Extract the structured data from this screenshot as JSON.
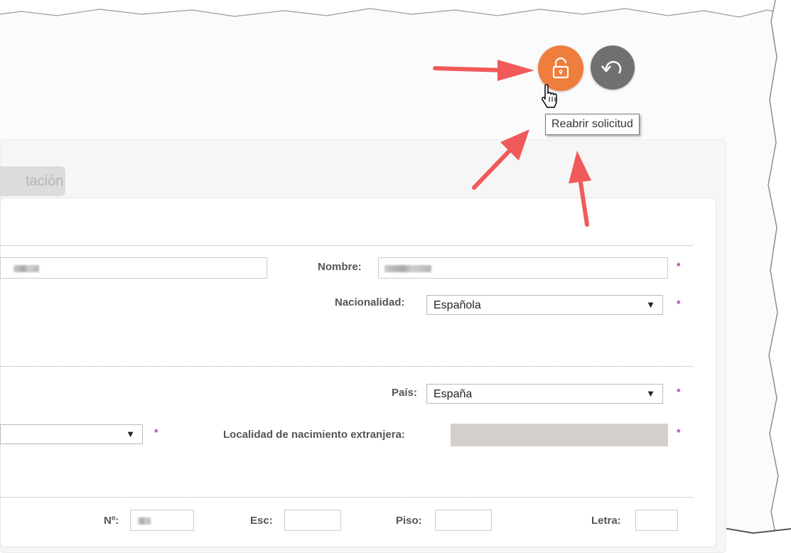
{
  "toolbar": {
    "reopen_tooltip": "Reabrir solicitud",
    "reopen_icon": "unlock-icon",
    "back_icon": "undo-icon",
    "reopen_color": "#ef7d3d",
    "back_color": "#707070"
  },
  "tabs": [
    {
      "label": "tación"
    }
  ],
  "form": {
    "nombre": {
      "label": "Nombre:",
      "required": "*"
    },
    "nacionalidad": {
      "label": "Nacionalidad:",
      "value": "Española",
      "required": "*"
    },
    "pais": {
      "label": "País:",
      "value": "España",
      "required": "*"
    },
    "provincia": {
      "required": "*"
    },
    "localidad_extranjera": {
      "label": "Localidad de nacimiento extranjera:",
      "required": "*"
    },
    "numero": {
      "label": "Nº:"
    },
    "escalera": {
      "label": "Esc:"
    },
    "piso": {
      "label": "Piso:"
    },
    "letra": {
      "label": "Letra:"
    }
  },
  "annotations": {
    "accent_color": "#f05a5a"
  }
}
